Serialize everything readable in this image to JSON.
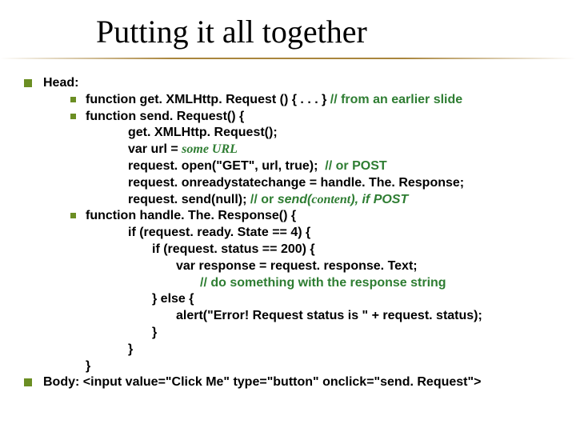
{
  "title": "Putting it all together",
  "head_label": "Head:",
  "fn1_sig": "function get. XMLHttp. Request () { . . . } ",
  "fn1_comment": "// from an earlier slide",
  "fn2_sig": "function send. Request() {",
  "fn2_l1": "get. XMLHttp. Request();",
  "fn2_l2a": "var url = ",
  "fn2_l2b": "some URL",
  "fn2_l3a": "request. open(\"GET\", url, true);  ",
  "fn2_l3b": "// or POST",
  "fn2_l4": "request. onreadystatechange = handle. The. Response;",
  "fn2_l5a": "request. send(null); ",
  "fn2_l5b": "// or ",
  "fn2_l5c": "send(",
  "fn2_l5d": "content",
  "fn2_l5e": "), if POST",
  "fn3_sig": "function handle. The. Response() {",
  "fn3_l1": "if (request. ready. State == 4) {",
  "fn3_l2": "if (request. status == 200) {",
  "fn3_l3": "var response = request. response. Text;",
  "fn3_l4": "// do something with the response string",
  "fn3_l5": "} else {",
  "fn3_l6": "alert(\"Error! Request status is \" + request. status);",
  "fn3_l7": "}",
  "fn3_l8": "}",
  "fn3_l9": "}",
  "body_label": "Body: ",
  "body_code": "<input value=\"Click Me\" type=\"button\" onclick=\"send. Request\">"
}
